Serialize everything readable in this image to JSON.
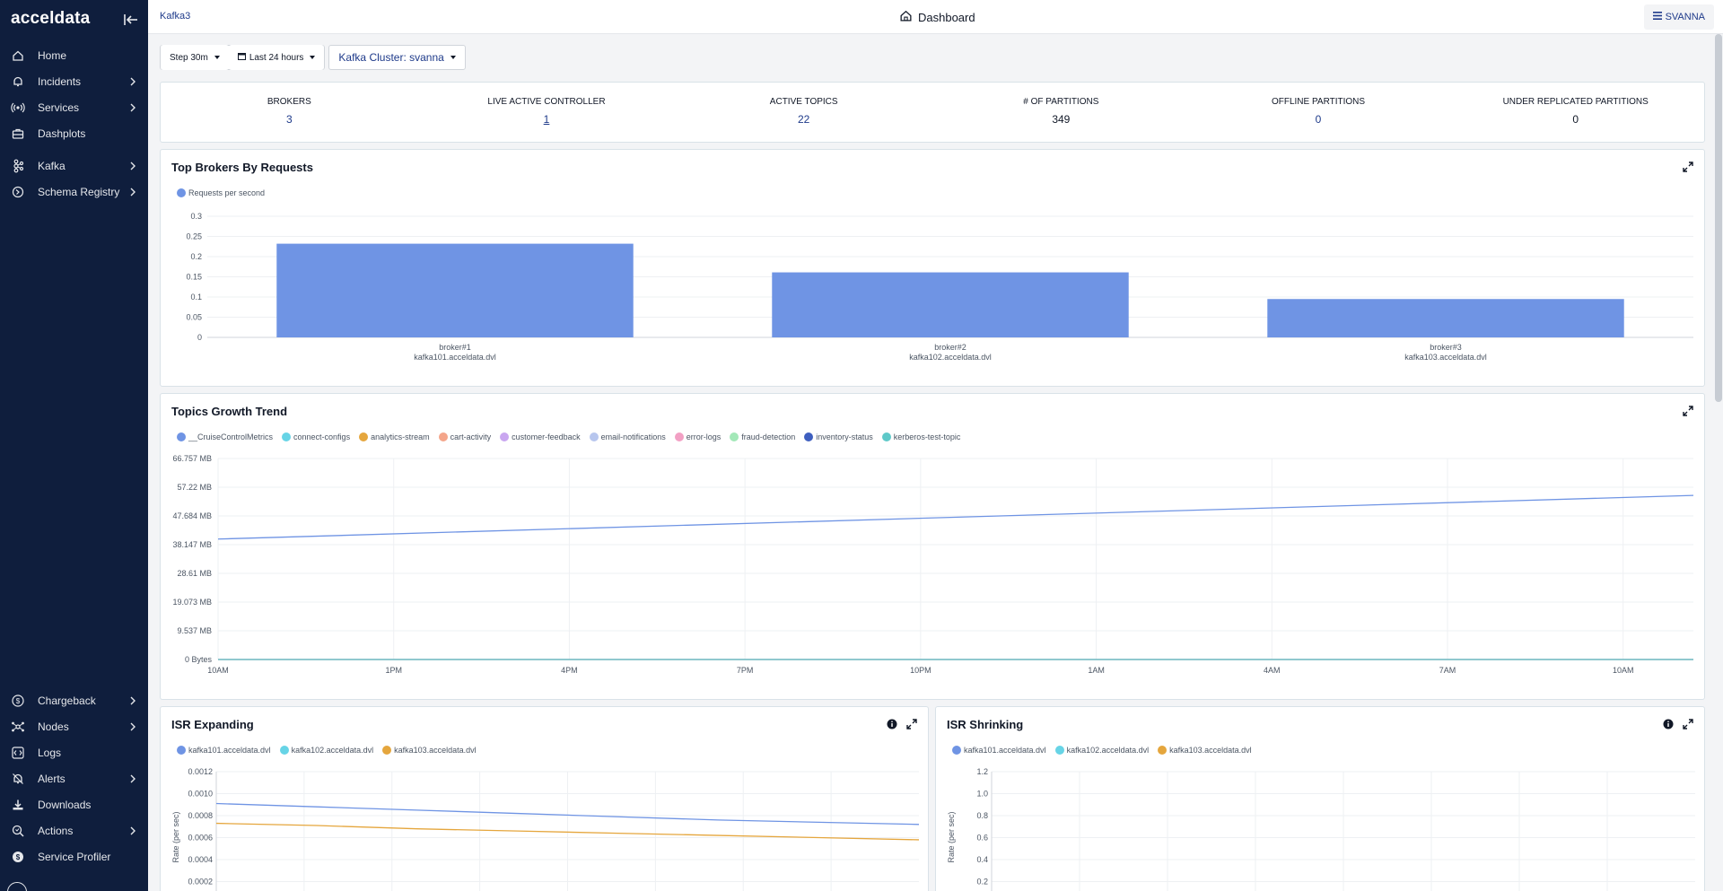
{
  "app": {
    "logo": "acceldata"
  },
  "sidebar": {
    "items": [
      {
        "label": "Home",
        "icon": "home-icon",
        "chevron": false
      },
      {
        "label": "Incidents",
        "icon": "bell-icon",
        "chevron": true
      },
      {
        "label": "Services",
        "icon": "broadcast-icon",
        "chevron": true
      },
      {
        "label": "Dashplots",
        "icon": "briefcase-icon",
        "chevron": false
      },
      {
        "label": "Kafka",
        "icon": "kafka-icon",
        "chevron": true
      },
      {
        "label": "Schema Registry",
        "icon": "registry-icon",
        "chevron": true
      }
    ],
    "bottom_items": [
      {
        "label": "Chargeback",
        "icon": "dollar-icon",
        "chevron": true
      },
      {
        "label": "Nodes",
        "icon": "nodes-icon",
        "chevron": true
      },
      {
        "label": "Logs",
        "icon": "code-icon",
        "chevron": false
      },
      {
        "label": "Alerts",
        "icon": "alert-bell-icon",
        "chevron": true
      },
      {
        "label": "Downloads",
        "icon": "download-icon",
        "chevron": false
      },
      {
        "label": "Actions",
        "icon": "actions-icon",
        "chevron": true
      },
      {
        "label": "Service Profiler",
        "icon": "profiler-icon",
        "chevron": false
      }
    ]
  },
  "header": {
    "breadcrumb": "Kafka3",
    "title": "Dashboard",
    "user": "SVANNA"
  },
  "filters": {
    "step": "Step 30m",
    "range": "Last 24 hours",
    "cluster": "Kafka Cluster: svanna"
  },
  "stats": [
    {
      "label": "BROKERS",
      "value": "3",
      "style": "link-color"
    },
    {
      "label": "LIVE ACTIVE CONTROLLER",
      "value": "1",
      "style": "link"
    },
    {
      "label": "ACTIVE TOPICS",
      "value": "22",
      "style": "link-color"
    },
    {
      "label": "# OF PARTITIONS",
      "value": "349",
      "style": "plain"
    },
    {
      "label": "OFFLINE PARTITIONS",
      "value": "0",
      "style": "link-color"
    },
    {
      "label": "UNDER REPLICATED PARTITIONS",
      "value": "0",
      "style": "plain"
    }
  ],
  "panels": {
    "brokers": {
      "title": "Top Brokers By Requests"
    },
    "topics": {
      "title": "Topics Growth Trend"
    },
    "isr_expanding": {
      "title": "ISR Expanding"
    },
    "isr_shrinking": {
      "title": "ISR Shrinking"
    }
  },
  "colors": {
    "accent": "#6f94e4",
    "sidebar": "#0f1e3d",
    "link": "#1e3a8a"
  },
  "chart_data": [
    {
      "id": "brokers",
      "type": "bar",
      "categories": [
        [
          "broker#1",
          "kafka101.acceldata.dvl"
        ],
        [
          "broker#2",
          "kafka102.acceldata.dvl"
        ],
        [
          "broker#3",
          "kafka103.acceldata.dvl"
        ]
      ],
      "series": [
        {
          "name": "Requests per second",
          "color": "#6f94e4",
          "values": [
            0.232,
            0.161,
            0.095
          ]
        }
      ],
      "yticks": [
        "0",
        "0.05",
        "0.1",
        "0.15",
        "0.2",
        "0.25",
        "0.3"
      ],
      "ylim": [
        0,
        0.3
      ],
      "grid": true,
      "legend": "top-left"
    },
    {
      "id": "topics",
      "type": "line",
      "x_labels": [
        "10AM",
        "1PM",
        "4PM",
        "7PM",
        "10PM",
        "1AM",
        "4AM",
        "7AM",
        "10AM"
      ],
      "yticks": [
        "0 Bytes",
        "9.537 MB",
        "19.073 MB",
        "28.61 MB",
        "38.147 MB",
        "47.684 MB",
        "57.22 MB",
        "66.757 MB"
      ],
      "ylim": [
        0,
        66.757
      ],
      "series": [
        {
          "name": "__CruiseControlMetrics",
          "color": "#6f94e4",
          "values": [
            40.0,
            54.5
          ]
        },
        {
          "name": "connect-configs",
          "color": "#67d4e6",
          "values": [
            0,
            0
          ]
        },
        {
          "name": "analytics-stream",
          "color": "#e5a63d",
          "values": [
            0,
            0
          ]
        },
        {
          "name": "cart-activity",
          "color": "#f4a58a",
          "values": [
            0,
            0
          ]
        },
        {
          "name": "customer-feedback",
          "color": "#c9a6f0",
          "values": [
            0,
            0
          ]
        },
        {
          "name": "email-notifications",
          "color": "#b7c6ee",
          "values": [
            0,
            0
          ]
        },
        {
          "name": "error-logs",
          "color": "#f2a0c4",
          "values": [
            0,
            0
          ]
        },
        {
          "name": "fraud-detection",
          "color": "#a3e8b8",
          "values": [
            0,
            0
          ]
        },
        {
          "name": "inventory-status",
          "color": "#3e5fbf",
          "values": [
            0,
            0
          ]
        },
        {
          "name": "kerberos-test-topic",
          "color": "#5ec9c9",
          "values": [
            0,
            0
          ]
        }
      ],
      "grid": true,
      "legend": "top-left"
    },
    {
      "id": "isr_expanding",
      "type": "line",
      "ylabel": "Rate (per sec)",
      "yticks": [
        "0.0002",
        "0.0004",
        "0.0006",
        "0.0008",
        "0.0010",
        "0.0012"
      ],
      "ylim": [
        0,
        0.0012
      ],
      "series": [
        {
          "name": "kafka101.acceldata.dvl",
          "color": "#6f94e4",
          "values": [
            0.00091,
            0.00088,
            0.00085,
            0.00082,
            0.00079,
            0.00076,
            0.00074,
            0.00072
          ]
        },
        {
          "name": "kafka102.acceldata.dvl",
          "color": "#67d4e6",
          "values": []
        },
        {
          "name": "kafka103.acceldata.dvl",
          "color": "#e5a63d",
          "values": [
            0.00073,
            0.00071,
            0.00068,
            0.00066,
            0.00064,
            0.00062,
            0.0006,
            0.00058
          ]
        }
      ],
      "grid": true,
      "legend": "top-left"
    },
    {
      "id": "isr_shrinking",
      "type": "line",
      "ylabel": "Rate (per sec)",
      "yticks": [
        "0.2",
        "0.4",
        "0.6",
        "0.8",
        "1.0",
        "1.2"
      ],
      "ylim": [
        0,
        1.2
      ],
      "series": [
        {
          "name": "kafka101.acceldata.dvl",
          "color": "#6f94e4",
          "values": []
        },
        {
          "name": "kafka102.acceldata.dvl",
          "color": "#67d4e6",
          "values": []
        },
        {
          "name": "kafka103.acceldata.dvl",
          "color": "#e5a63d",
          "values": []
        }
      ],
      "grid": true,
      "legend": "top-left"
    }
  ]
}
